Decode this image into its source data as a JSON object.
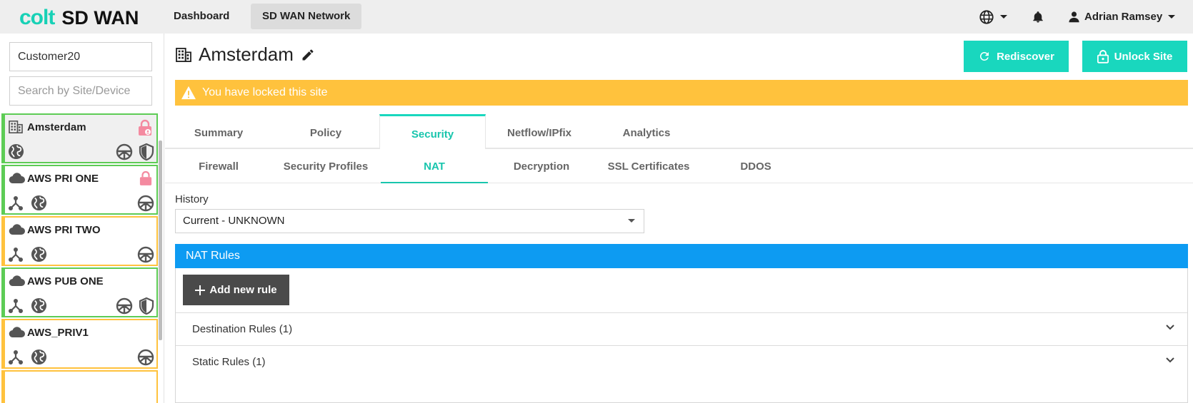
{
  "brand": {
    "colt": "colt",
    "product": "SD WAN"
  },
  "nav": {
    "dashboard": "Dashboard",
    "sdwan_network": "SD WAN Network"
  },
  "user": {
    "name": "Adrian Ramsey"
  },
  "sidebar": {
    "customer_value": "Customer20",
    "search_placeholder": "Search by Site/Device",
    "sites": [
      {
        "name": "Amsterdam",
        "status": "green",
        "selected": true
      },
      {
        "name": "AWS PRI ONE",
        "status": "green"
      },
      {
        "name": "AWS PRI TWO",
        "status": "orange"
      },
      {
        "name": "AWS PUB ONE",
        "status": "green"
      },
      {
        "name": "AWS_PRIV1",
        "status": "orange"
      }
    ]
  },
  "site": {
    "title": "Amsterdam",
    "rediscover_label": "Rediscover",
    "unlock_label": "Unlock Site",
    "lock_banner": "You have locked this site"
  },
  "tabs": [
    "Summary",
    "Policy",
    "Security",
    "Netflow/IPfix",
    "Analytics"
  ],
  "subtabs": [
    "Firewall",
    "Security Profiles",
    "NAT",
    "Decryption",
    "SSL Certificates",
    "DDOS"
  ],
  "history": {
    "label": "History",
    "selected": "Current - UNKNOWN"
  },
  "nat": {
    "header": "NAT Rules",
    "add_rule_label": "Add new rule",
    "rules": [
      "Destination Rules (1)",
      "Static Rules (1)"
    ]
  },
  "colors": {
    "accent": "#19d7be",
    "warning": "#ffc23d",
    "info": "#0d9bf2",
    "ok": "#5dcc55",
    "lock": "#f48aa0"
  }
}
